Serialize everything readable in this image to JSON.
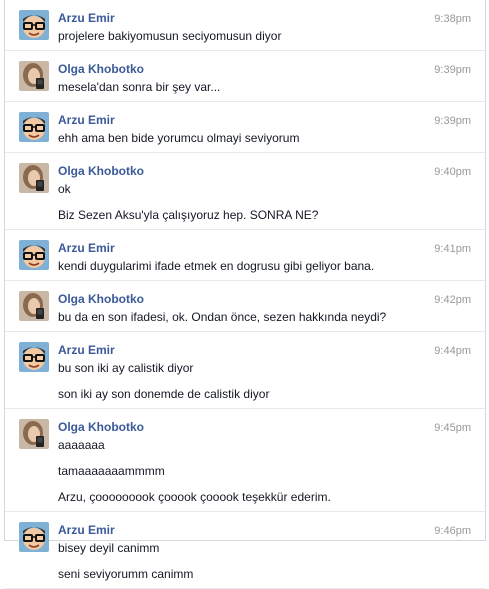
{
  "colors": {
    "sender": "#3b5998",
    "text": "#141823",
    "timestamp": "#999999",
    "divider": "#e9eaed"
  },
  "messages": [
    {
      "sender": "Arzu Emir",
      "avatar": "arzu-avatar-cartoon-glasses",
      "time": "9:38pm",
      "lines": [
        "projelere bakiyomusun seciyomusun diyor"
      ]
    },
    {
      "sender": "Olga Khobotko",
      "avatar": "olga-avatar-photo",
      "time": "9:39pm",
      "lines": [
        "mesela'dan sonra bir şey var..."
      ]
    },
    {
      "sender": "Arzu Emir",
      "avatar": "arzu-avatar-cartoon-glasses",
      "time": "9:39pm",
      "lines": [
        "ehh ama ben bide yorumcu olmayi seviyorum"
      ]
    },
    {
      "sender": "Olga Khobotko",
      "avatar": "olga-avatar-photo",
      "time": "9:40pm",
      "lines": [
        "ok",
        "Biz Sezen Aksu'yla çalışıyoruz hep. SONRA NE?"
      ]
    },
    {
      "sender": "Arzu Emir",
      "avatar": "arzu-avatar-cartoon-glasses",
      "time": "9:41pm",
      "lines": [
        "kendi duygularimi ifade etmek en dogrusu gibi geliyor bana."
      ]
    },
    {
      "sender": "Olga Khobotko",
      "avatar": "olga-avatar-photo",
      "time": "9:42pm",
      "lines": [
        "bu da en son ifadesi, ok. Ondan önce, sezen hakkında neydi?"
      ]
    },
    {
      "sender": "Arzu Emir",
      "avatar": "arzu-avatar-cartoon-glasses",
      "time": "9:44pm",
      "lines": [
        "bu son iki ay calistik diyor",
        "son iki ay son donemde de calistik diyor"
      ]
    },
    {
      "sender": "Olga Khobotko",
      "avatar": "olga-avatar-photo",
      "time": "9:45pm",
      "lines": [
        "aaaaaaa",
        "tamaaaaaaammmm",
        "Arzu, çooooooook çooook çooook teşekkür ederim."
      ]
    },
    {
      "sender": "Arzu Emir",
      "avatar": "arzu-avatar-cartoon-glasses",
      "time": "9:46pm",
      "lines": [
        "bisey deyil canimm",
        "seni seviyorumm canimm"
      ]
    }
  ]
}
